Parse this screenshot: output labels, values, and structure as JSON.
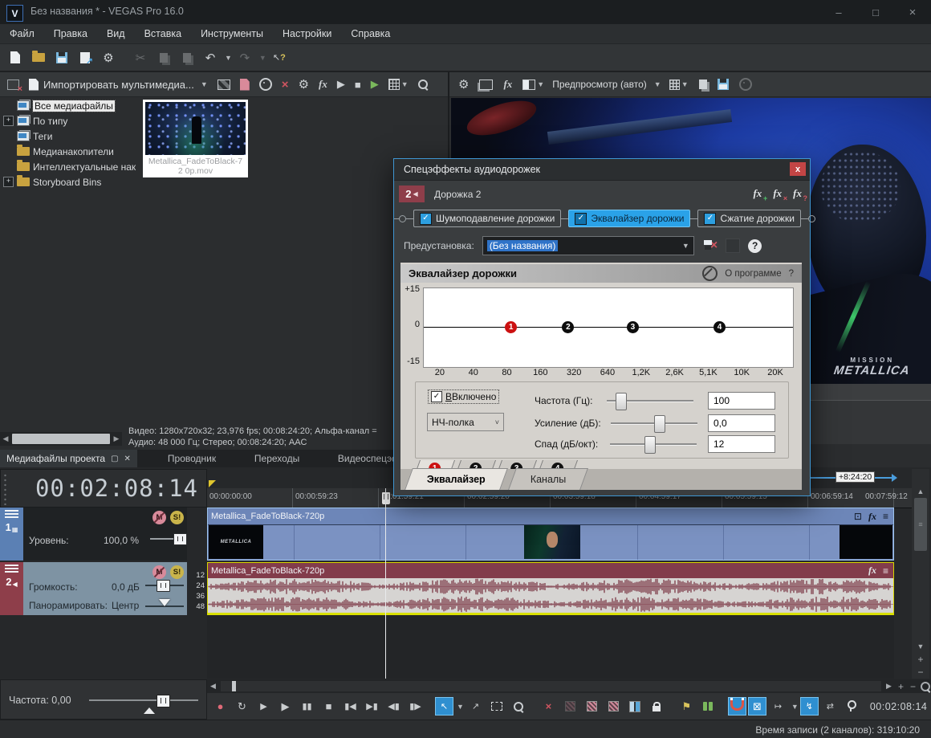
{
  "window": {
    "title": "Без названия * - VEGAS Pro 16.0",
    "logo": "V",
    "controls": {
      "minimize": "–",
      "maximize": "□",
      "close": "×"
    }
  },
  "menu": {
    "items": [
      "Файл",
      "Правка",
      "Вид",
      "Вставка",
      "Инструменты",
      "Настройки",
      "Справка"
    ]
  },
  "main_toolbar": {
    "buttons": [
      {
        "name": "new-project"
      },
      {
        "name": "open-project"
      },
      {
        "name": "save-project"
      },
      {
        "name": "publish-project"
      },
      {
        "name": "project-properties",
        "glyph": "⚙"
      },
      {
        "name": "cut",
        "glyph": "✂",
        "disabled": true
      },
      {
        "name": "copy",
        "disabled": true
      },
      {
        "name": "paste",
        "disabled": true
      },
      {
        "name": "undo",
        "glyph": "↶"
      },
      {
        "name": "redo",
        "glyph": "↷",
        "disabled": true
      },
      {
        "name": "whats-this-help",
        "glyph": "?"
      }
    ]
  },
  "media_panel": {
    "import_button": "Импортировать мультимедиа...",
    "toolbar_icons": [
      "close-media-bin",
      "import-media",
      "device-preview",
      "import-file",
      "extract-audio-from-cd",
      "remove-selected-media",
      "media-properties",
      "media-fx",
      "start-preview",
      "stop-preview",
      "auto-preview",
      "views",
      "search-media-bins"
    ],
    "toolbar_glyphs": {
      "remove": "×",
      "properties": "⚙",
      "fx": "fx",
      "play": "▶",
      "stop": "■",
      "autoplay": "▶"
    },
    "tree": {
      "items": [
        {
          "label": "Все медиафайлы",
          "selected": true,
          "icon": "media-stack"
        },
        {
          "label": "По типу",
          "expander": "+",
          "icon": "media-stack"
        },
        {
          "label": "Теги",
          "icon": "media-stack"
        },
        {
          "label": "Медианакопители",
          "icon": "folder"
        },
        {
          "label": "Интеллектуальные нак",
          "icon": "folder"
        },
        {
          "label": "Storyboard Bins",
          "expander": "+",
          "icon": "folder"
        }
      ]
    },
    "clip": {
      "caption": "Metallica_FadeToBlack-72 0p.mov"
    },
    "info": {
      "video": "Видео: 1280x720x32; 23,976 fps; 00:08:24:20; Альфа-канал =",
      "audio": "Аудио: 48 000 Гц; Стерео; 00:08:24:20; AAC"
    },
    "dock_tabs": [
      {
        "label": "Медиафайлы проекта",
        "active": true
      },
      {
        "label": "Проводник"
      },
      {
        "label": "Переходы"
      },
      {
        "label": "Видеоспецэффекты"
      }
    ]
  },
  "preview": {
    "toolbar_label": "Предпросмотр (авто)",
    "toolbar_icons": [
      "preview-settings",
      "external-monitor",
      "video-output-fx",
      "split-screen-view",
      "preview-quality",
      "grid-overlay",
      "copy-snapshot",
      "save-snapshot",
      "scrub-control"
    ],
    "fx_glyph": "fx",
    "settings_glyph": "⚙",
    "watermark_top": "MISSION",
    "watermark_bottom": "METALLICA"
  },
  "fx_dialog": {
    "title": "Спецэффекты аудиодорожек",
    "close_glyph": "x",
    "track_number": "2",
    "track_name": "Дорожка 2",
    "header_icons": [
      {
        "name": "add-fx",
        "glyph": "fx",
        "badge": "+"
      },
      {
        "name": "remove-fx",
        "glyph": "fx",
        "badge": "×"
      },
      {
        "name": "fx-automation",
        "glyph": "fx",
        "badge": "?"
      }
    ],
    "chain": {
      "items": [
        {
          "label": "Шумоподавление дорожки",
          "checked": true,
          "check_glyph": "✓"
        },
        {
          "label": "Эквалайзер дорожки",
          "checked": true,
          "selected": true,
          "check_glyph": "✓"
        },
        {
          "label": "Сжатие дорожки",
          "checked": true,
          "check_glyph": "✓"
        }
      ]
    },
    "preset": {
      "label": "Предустановка:",
      "value": "(Без названия)",
      "delete_glyph": "×",
      "help_glyph": "?"
    },
    "plugin": {
      "title": "Эквалайзер дорожки",
      "about_label": "О программе",
      "help_label": "?",
      "graph": {
        "type": "line",
        "y_labels": [
          "+15",
          "0",
          "-15"
        ],
        "y_range_db": [
          -15,
          15
        ],
        "x_labels": [
          "20",
          "40",
          "80",
          "160",
          "320",
          "640",
          "1,2K",
          "2,6K",
          "5,1K",
          "10K",
          "20K"
        ],
        "bands": [
          {
            "num": "1",
            "freq_pct": 23.5,
            "gain_db": 0,
            "selected": true
          },
          {
            "num": "2",
            "freq_pct": 39,
            "gain_db": 0
          },
          {
            "num": "3",
            "freq_pct": 56.5,
            "gain_db": 0
          },
          {
            "num": "4",
            "freq_pct": 80,
            "gain_db": 0
          }
        ]
      },
      "enabled_label": "Включено",
      "enabled_check": "✓",
      "filter_type_value": "НЧ-полка",
      "params": [
        {
          "label": "Частота (Гц):",
          "value": "100",
          "slider_pct": 10
        },
        {
          "label": "Усиление (дБ):",
          "value": "0,0",
          "slider_pct": 50
        },
        {
          "label": "Спад (дБ/окт):",
          "value": "12",
          "slider_pct": 40
        }
      ],
      "band_tabs": [
        "1",
        "2",
        "3",
        "4"
      ],
      "bottom_tabs": [
        {
          "label": "Эквалайзер",
          "active": true
        },
        {
          "label": "Каналы"
        }
      ]
    }
  },
  "timeline": {
    "timecode": "00:02:08:14",
    "end_marker_label": "+8:24:20",
    "ruler_labels": [
      "00:00:00:00",
      "00:00:59:23",
      "00:01:59:21",
      "00:02:59:20",
      "00:03:59:18",
      "00:04:59:17",
      "00:05:59:15",
      "00:06:59:14",
      "00:07:59:12"
    ],
    "video_track": {
      "number": "1",
      "level_label": "Уровень:",
      "level_value": "100,0 %",
      "mute_glyph": "M",
      "solo_glyph": "S!"
    },
    "audio_track": {
      "number": "2",
      "volume_label": "Громкость:",
      "volume_value": "0,0 дБ",
      "pan_label": "Панорамировать:",
      "pan_value": "Центр",
      "mute_glyph": "M",
      "solo_glyph": "S!",
      "db_scale": [
        "12",
        "24",
        "36",
        "48"
      ]
    },
    "video_event_name": "Metallica_FadeToBlack-720p",
    "audio_event_name": "Metallica_FadeToBlack-720p",
    "video_event_icons": [
      "crop",
      "event-fx",
      "event-menu"
    ],
    "event_fx_glyph": "fx",
    "event_menu_glyph": "≡",
    "crop_glyph": "⊡"
  },
  "transport": {
    "timecode": "00:02:08:14",
    "buttons": [
      {
        "name": "record",
        "glyph": "●"
      },
      {
        "name": "loop-playback",
        "glyph": "↻"
      },
      {
        "name": "play-from-start",
        "glyph": "▶"
      },
      {
        "name": "play",
        "glyph": "▶"
      },
      {
        "name": "pause",
        "glyph": "▮▮"
      },
      {
        "name": "stop",
        "glyph": "■"
      },
      {
        "name": "go-to-start",
        "glyph": "▮◀"
      },
      {
        "name": "go-to-end",
        "glyph": "▶▮"
      },
      {
        "name": "previous-frame",
        "glyph": "◀▮"
      },
      {
        "name": "next-frame",
        "glyph": "▮▶"
      },
      {
        "name": "normal-edit-tool",
        "glyph": "↖",
        "active": true
      },
      {
        "name": "envelope-edit-tool",
        "glyph": "↗"
      },
      {
        "name": "selection-edit-tool"
      },
      {
        "name": "zoom-edit-tool"
      },
      {
        "name": "delete",
        "glyph": "×"
      },
      {
        "name": "trim",
        "disabled": true
      },
      {
        "name": "trim-start"
      },
      {
        "name": "trim-end"
      },
      {
        "name": "split"
      },
      {
        "name": "lock-event"
      },
      {
        "name": "insert-marker",
        "glyph": "⚑"
      },
      {
        "name": "insert-region"
      },
      {
        "name": "enable-snapping",
        "active": true
      },
      {
        "name": "auto-ripple",
        "glyph": "⊠",
        "active": true
      },
      {
        "name": "ripple-edits",
        "glyph": "↦"
      },
      {
        "name": "lock-envelopes-to-events",
        "glyph": "↯",
        "active": true
      },
      {
        "name": "ignore-event-grouping",
        "glyph": "⇄"
      },
      {
        "name": "paste-marker"
      }
    ]
  },
  "status_bar": {
    "frequency": "Частота: 0,00",
    "record_time": "Время записи (2 каналов): 319:10:20"
  },
  "colors": {
    "accent_blue": "#2aa2e8",
    "track_video_tab": "#5b80b4",
    "track_audio_tab": "#8e3e4a",
    "video_event": "#7b92c2",
    "waveform": "#7c3a48",
    "event_selection": "#d6d600",
    "record_red": "#e06a78",
    "marker_yellow": "#d9c35c",
    "region_green": "#7ab85c",
    "dialog_border": "#3f96d2"
  }
}
